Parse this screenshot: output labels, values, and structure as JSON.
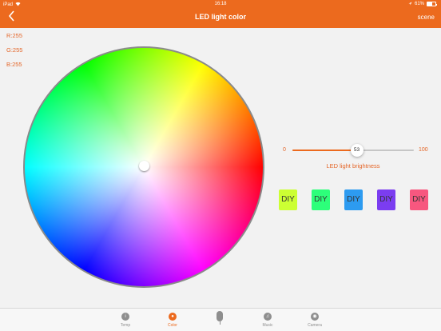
{
  "status_bar": {
    "device": "iPad",
    "time": "16:18",
    "battery_pct": "61%",
    "battery_level": 0.61
  },
  "nav": {
    "back_icon": "chevron-left-icon",
    "title": "LED light color",
    "scene_label": "scene"
  },
  "rgb": {
    "r_label": "R:255",
    "g_label": "G:255",
    "b_label": "B:255"
  },
  "brightness": {
    "min_label": "0",
    "max_label": "100",
    "value": 53,
    "value_label": "53",
    "caption": "LED light brightness"
  },
  "diy_buttons": [
    {
      "label": "DIY",
      "color": "#ccff33"
    },
    {
      "label": "DIY",
      "color": "#2dff7a"
    },
    {
      "label": "DIY",
      "color": "#2d9bf0"
    },
    {
      "label": "DIY",
      "color": "#7b3df0"
    },
    {
      "label": "DIY",
      "color": "#f7577f"
    }
  ],
  "tabs": [
    {
      "label": "Temp",
      "icon": "temperature-icon",
      "active": false
    },
    {
      "label": "Color",
      "icon": "palette-icon",
      "active": true
    },
    {
      "label": "",
      "icon": "microphone-icon",
      "active": false
    },
    {
      "label": "Music",
      "icon": "music-note-icon",
      "active": false
    },
    {
      "label": "Camera",
      "icon": "camera-icon",
      "active": false
    }
  ],
  "colors": {
    "accent": "#ec6a1e",
    "label_orange": "#e4672a",
    "inactive_tab": "#8e8e8e"
  }
}
